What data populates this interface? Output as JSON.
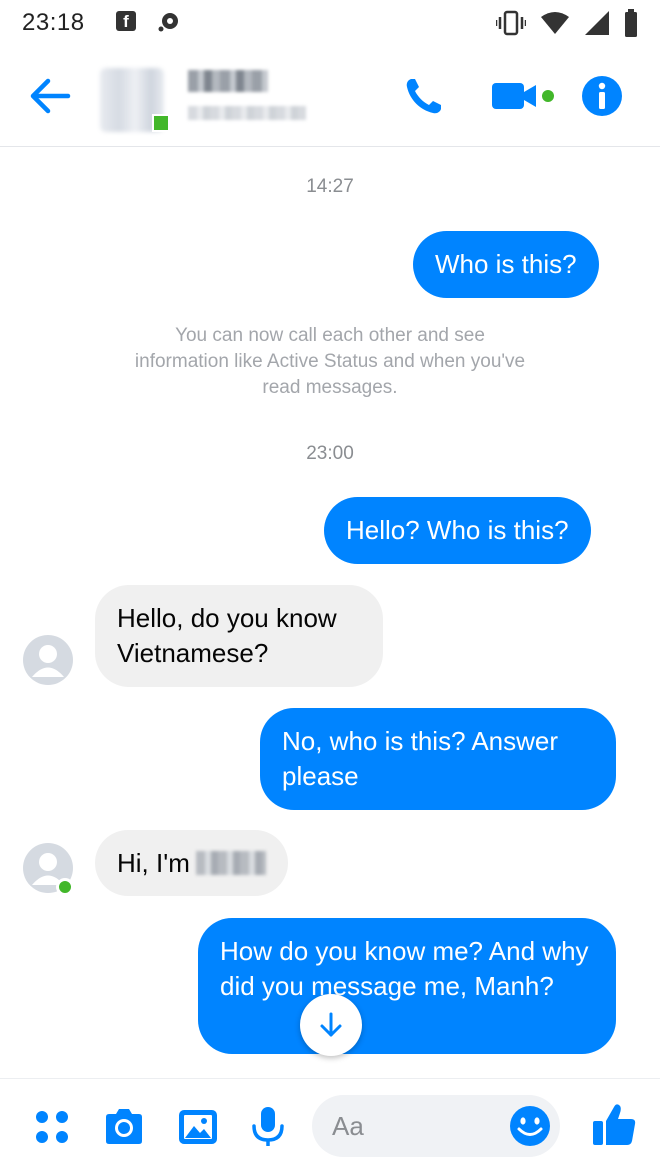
{
  "status_bar": {
    "time": "23:18",
    "fb_glyph": "f",
    "icons": [
      "facebook-notification-icon",
      "messenger-notification-icon",
      "vibrate-icon",
      "wifi-icon",
      "signal-icon",
      "battery-icon"
    ]
  },
  "header": {
    "contact_online": true,
    "icons": [
      "back-arrow-icon",
      "phone-icon",
      "video-camera-icon",
      "info-icon"
    ]
  },
  "conversation": {
    "timestamps": [
      "14:27",
      "23:00"
    ],
    "system_note": "You can now call each other and see information like Active Status and when you've read messages.",
    "messages": [
      {
        "direction": "outgoing",
        "text": "Who is this?"
      },
      {
        "direction": "outgoing",
        "text": "Hello? Who is this?"
      },
      {
        "direction": "incoming",
        "text": "Hello, do you know Vietnamese?"
      },
      {
        "direction": "outgoing",
        "text": "No, who is this? Answer please"
      },
      {
        "direction": "incoming",
        "text": "Hi, I'm"
      },
      {
        "direction": "outgoing",
        "text": "How do you know me? And why did you message me, Manh?"
      }
    ]
  },
  "composer": {
    "placeholder": "Aa",
    "icons": [
      "more-options-icon",
      "camera-icon",
      "gallery-icon",
      "microphone-icon",
      "emoji-icon",
      "thumbs-up-icon"
    ]
  },
  "colors": {
    "messenger_blue": "#0084ff",
    "incoming_bubble": "#f0f0f0",
    "online_green": "#42b72a",
    "meta_text": "#8a8d91"
  }
}
